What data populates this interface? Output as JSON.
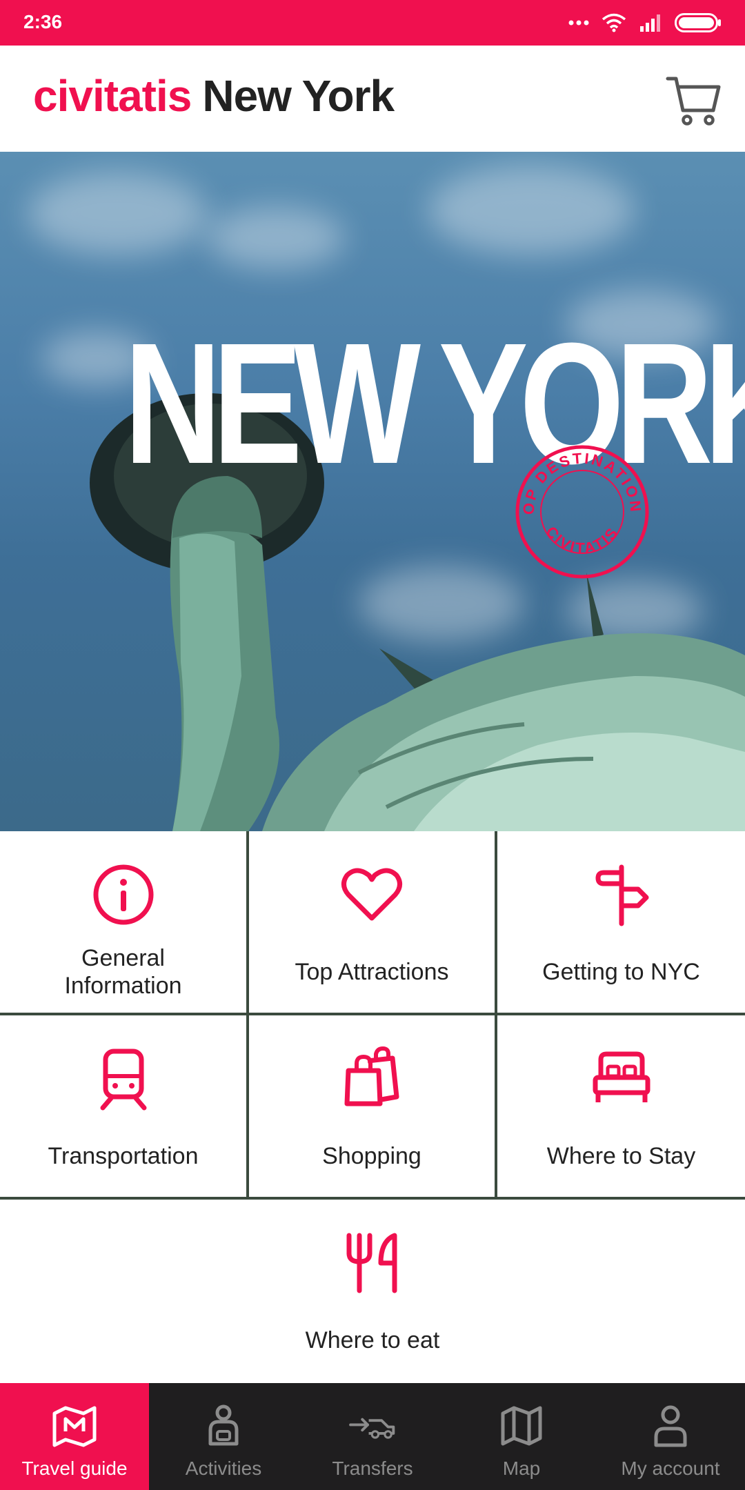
{
  "status_bar": {
    "time": "2:36"
  },
  "header": {
    "brand": "civitatis",
    "city": "New York"
  },
  "hero": {
    "title": "NEW YORK",
    "badge_top": "TOP DESTINATIONS",
    "badge_bottom": "CIVITATIS"
  },
  "menu": {
    "items": [
      {
        "label": "General Information",
        "icon": "info-icon"
      },
      {
        "label": "Top Attractions",
        "icon": "heart-icon"
      },
      {
        "label": "Getting to NYC",
        "icon": "signpost-icon"
      },
      {
        "label": "Transportation",
        "icon": "train-icon"
      },
      {
        "label": "Shopping",
        "icon": "shopping-bag-icon"
      },
      {
        "label": "Where to Stay",
        "icon": "bed-icon"
      },
      {
        "label": "Where to eat",
        "icon": "cutlery-icon"
      }
    ]
  },
  "bottom_nav": {
    "items": [
      {
        "label": "Travel guide",
        "icon": "map-pin-icon",
        "active": true
      },
      {
        "label": "Activities",
        "icon": "activities-icon"
      },
      {
        "label": "Transfers",
        "icon": "car-icon"
      },
      {
        "label": "Map",
        "icon": "map-icon"
      },
      {
        "label": "My account",
        "icon": "user-icon"
      }
    ]
  },
  "colors": {
    "accent": "#f0104f",
    "nav_bg": "#1f1e1f",
    "inactive": "#8c8c8c"
  }
}
